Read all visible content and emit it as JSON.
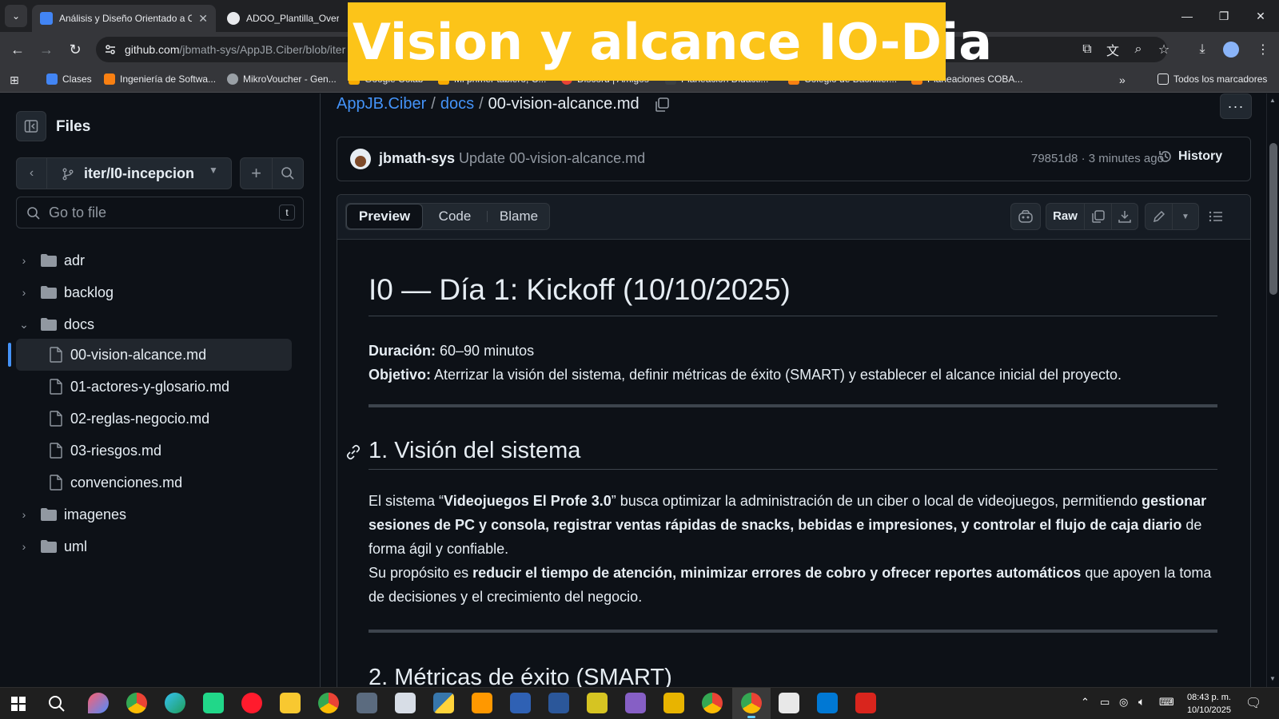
{
  "browser": {
    "tabs": [
      {
        "title": "Análisis y Diseño Orientado a O",
        "active": true
      },
      {
        "title": "ADOO_Plantilla_Overleaf",
        "active": false
      }
    ],
    "url_host": "github.com",
    "url_path": "/jbmath-sys/AppJB.Ciber/blob/iter"
  },
  "bookmarks": [
    "Clases",
    "Ingeniería de Softwa...",
    "MikroVoucher - Gen...",
    "Google Colab",
    "Mi primer tablero, C...",
    "Discord | Amigos",
    "Planeación Didácti...",
    "Colegio de Bachiller...",
    "Planeaciones COBA...",
    "Todos los marcadores"
  ],
  "banner": {
    "text": "Vision y alcance IO-Dia"
  },
  "sidebar": {
    "title": "Files",
    "branch": "iter/I0-incepcion",
    "go_to_file_placeholder": "Go to file",
    "go_to_file_shortcut": "t",
    "tree": [
      {
        "name": "adr",
        "type": "folder",
        "expanded": false
      },
      {
        "name": "backlog",
        "type": "folder",
        "expanded": false
      },
      {
        "name": "docs",
        "type": "folder",
        "expanded": true
      },
      {
        "name": "00-vision-alcance.md",
        "type": "file",
        "selected": true
      },
      {
        "name": "01-actores-y-glosario.md",
        "type": "file"
      },
      {
        "name": "02-reglas-negocio.md",
        "type": "file"
      },
      {
        "name": "03-riesgos.md",
        "type": "file"
      },
      {
        "name": "convenciones.md",
        "type": "file"
      },
      {
        "name": "imagenes",
        "type": "folder",
        "expanded": false
      },
      {
        "name": "uml",
        "type": "folder",
        "expanded": false
      }
    ]
  },
  "breadcrumb": {
    "repo": "AppJB.Ciber",
    "sep": "/",
    "dir": "docs",
    "file": "00-vision-alcance.md"
  },
  "commit": {
    "author": "jbmath-sys",
    "message": "Update 00-vision-alcance.md",
    "meta": "79851d8 · 3 minutes ago",
    "history_label": "History"
  },
  "view_tabs": [
    "Preview",
    "Code",
    "Blame"
  ],
  "file_actions": {
    "raw_label": "Raw"
  },
  "doc": {
    "h1": "I0 — Día 1: Kickoff (10/10/2025)",
    "duracion_label": "Duración:",
    "duracion_value": " 60–90 minutos",
    "objetivo_label": "Objetivo:",
    "objetivo_value": " Aterrizar la visión del sistema, definir métricas de éxito (SMART) y establecer el alcance inicial del proyecto.",
    "h2_vision": "1. Visión del sistema",
    "vision_p1_a": "El sistema “",
    "vision_p1_b": "Videojuegos El Profe 3.0",
    "vision_p1_c": "” busca optimizar la administración de un ciber o local de videojuegos, permitiendo ",
    "vision_p1_d": "gestionar sesiones de PC y consola, registrar ventas rápidas de snacks, bebidas e impresiones, y controlar el flujo de caja diario",
    "vision_p1_e": " de forma ágil y confiable.",
    "vision_p2_a": "Su propósito es ",
    "vision_p2_b": "reducir el tiempo de atención, minimizar errores de cobro y ofrecer reportes automáticos",
    "vision_p2_c": " que apoyen la toma de decisiones y el crecimiento del negocio.",
    "h2_metricas": "2. Métricas de éxito (SMART)"
  },
  "taskbar": {
    "time": "08:43 p. m.",
    "date": "10/10/2025"
  },
  "colors": {
    "banner": "#fcc419",
    "link": "#4493f8",
    "bg": "#0d1117",
    "border": "#30363d"
  }
}
